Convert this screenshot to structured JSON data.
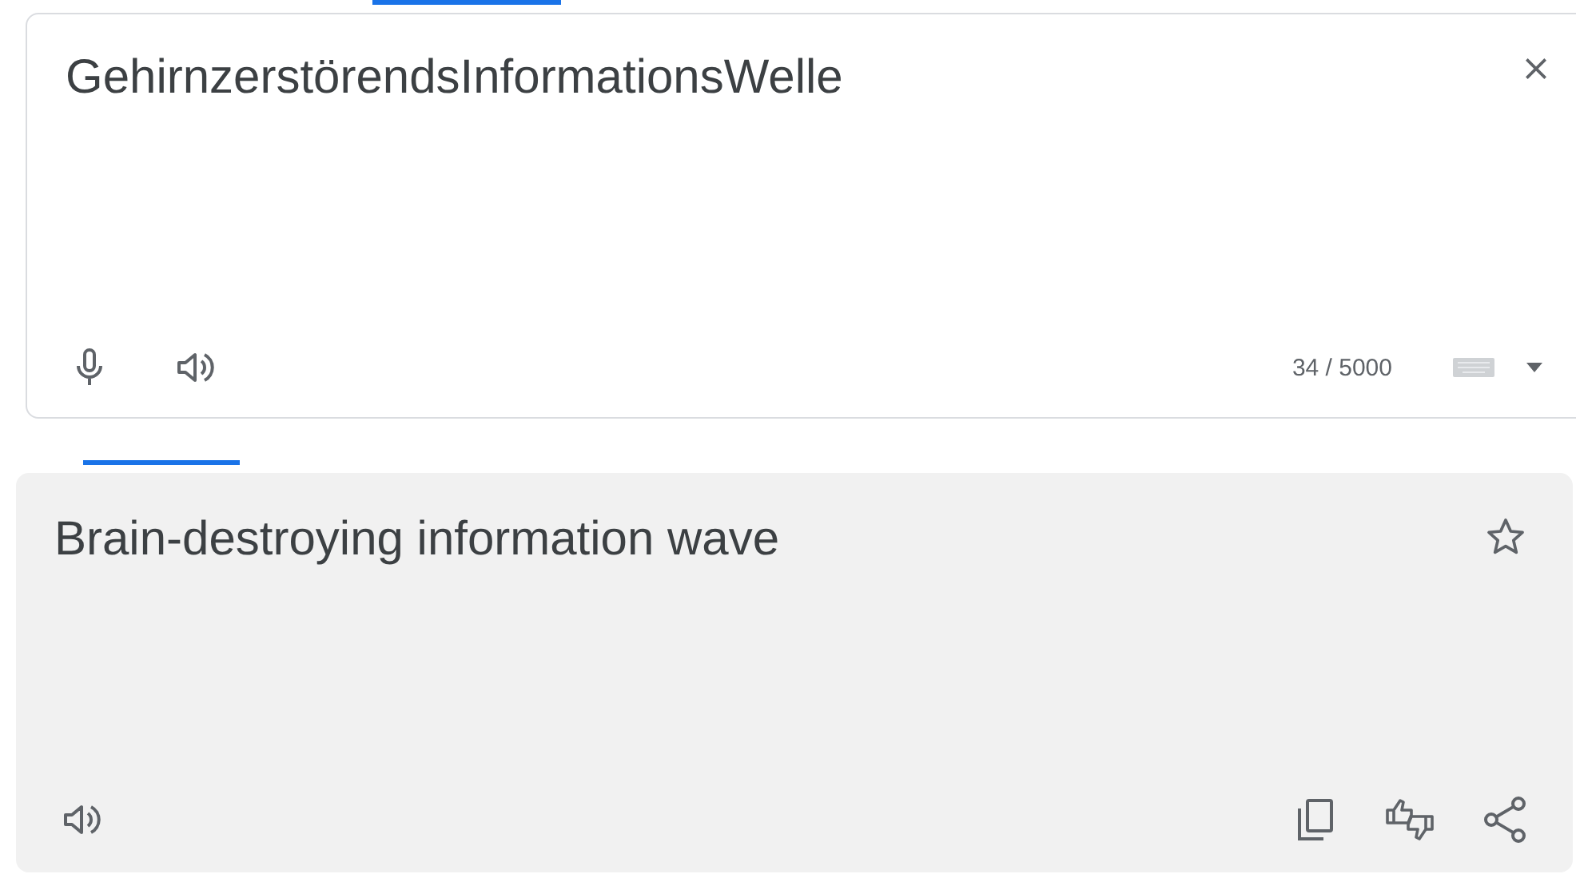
{
  "source": {
    "text": "GehirnzerstörendsInformationsWelle",
    "char_count": "34 / 5000"
  },
  "translation": {
    "text": "Brain-destroying information wave",
    "starred": false
  }
}
